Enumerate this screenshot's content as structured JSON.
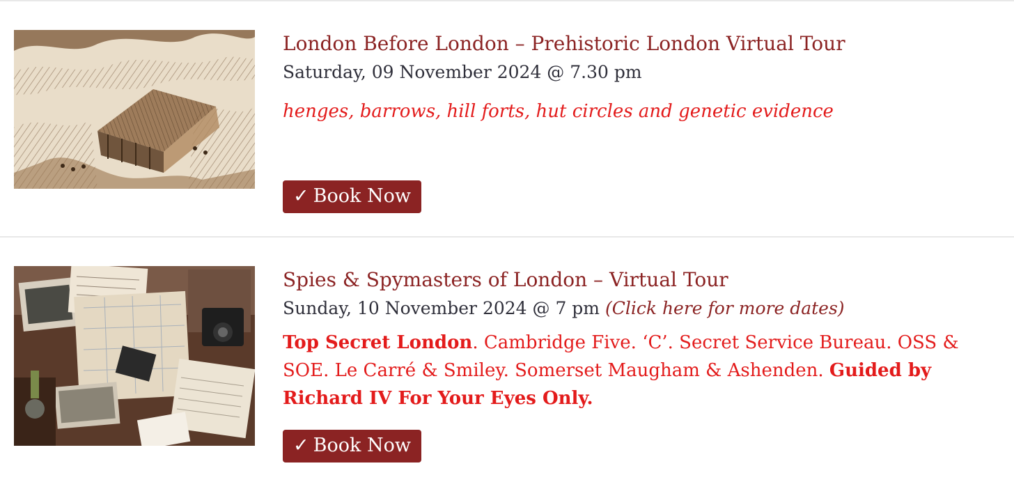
{
  "events": [
    {
      "title": "London Before London – Prehistoric London Virtual Tour",
      "date": "Saturday, 09 November 2024 @ 7.30 pm",
      "description": "henges, barrows, hill forts, hut circles and genetic evidence",
      "book_icon": "✓",
      "book_label": "Book Now"
    },
    {
      "title": "Spies & Spymasters of London – Virtual Tour",
      "date": "Sunday, 10 November 2024 @ 7 pm",
      "more_dates": "(Click here for more dates)",
      "description_bold_1": "Top Secret London",
      "description_plain": ". Cambridge Five. ‘C’. Secret Service Bureau. OSS & SOE. Le Carré & Smiley. Somerset Maugham & Ashenden. ",
      "description_bold_2": "Guided by Richard IV For Your Eyes Only.",
      "book_icon": "✓",
      "book_label": "Book Now"
    }
  ],
  "colors": {
    "title": "#8b2323",
    "accent_red": "#e31b1b",
    "button_bg": "#8b2323",
    "date_text": "#2f2f3a",
    "divider": "#e8e8e8"
  }
}
